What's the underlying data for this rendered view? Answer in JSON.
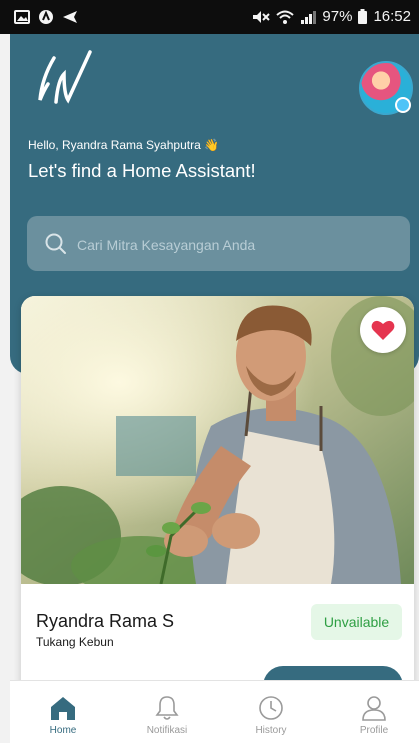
{
  "status_bar": {
    "battery": "97%",
    "time": "16:52"
  },
  "header": {
    "greeting": "Hello, Ryandra Rama Syahputra 👋",
    "headline": "Let's find a Home Assistant!"
  },
  "search": {
    "placeholder": "Cari Mitra Kesayangan Anda"
  },
  "card": {
    "name": "Ryandra Rama S",
    "job": "Tukang Kebun",
    "status": "Unvailable",
    "favorited": true
  },
  "nav": {
    "items": [
      {
        "label": "Home",
        "icon": "home-icon",
        "active": true
      },
      {
        "label": "Notifikasi",
        "icon": "bell-icon",
        "active": false
      },
      {
        "label": "History",
        "icon": "clock-icon",
        "active": false
      },
      {
        "label": "Profile",
        "icon": "person-icon",
        "active": false
      }
    ]
  },
  "colors": {
    "primary": "#366b7f",
    "available_text": "#2e9f43",
    "available_bg": "#e5f7e7",
    "heart": "#e5354f"
  }
}
